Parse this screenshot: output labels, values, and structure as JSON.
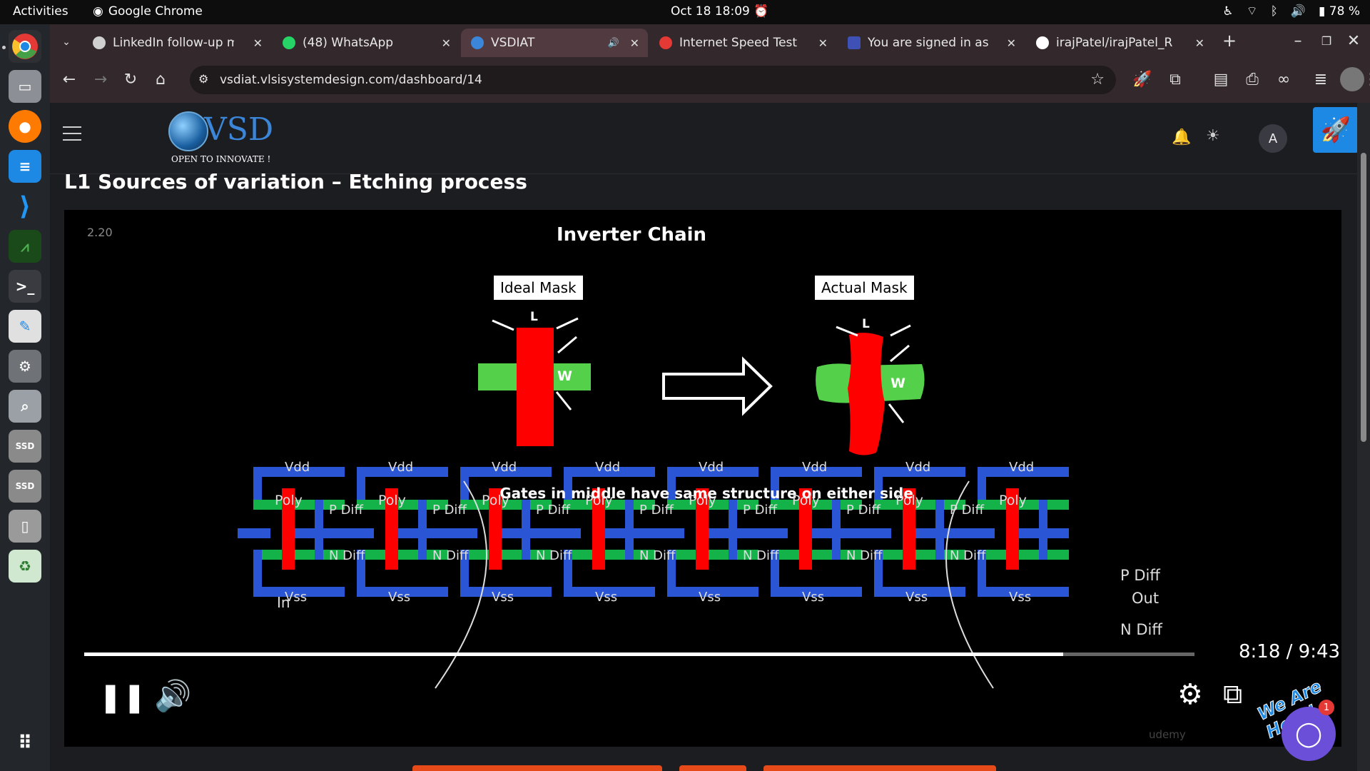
{
  "topbar": {
    "activities": "Activities",
    "app_name": "Google Chrome",
    "clock": "Oct 18  18:09",
    "battery": "78 %"
  },
  "tabs": [
    {
      "title": "LinkedIn follow-up m",
      "color": "#d0d0d0"
    },
    {
      "title": "(48) WhatsApp",
      "color": "#25d366"
    },
    {
      "title": "VSDIAT",
      "color": "#3b86d8"
    },
    {
      "title": "Internet Speed Test",
      "color": "#e53935"
    },
    {
      "title": "You are signed in as",
      "color": "#3f51b5"
    },
    {
      "title": "irajPatel/irajPatel_R",
      "color": "#ffffff"
    }
  ],
  "omnibox": {
    "url": "vsdiat.vlsisystemdesign.com/dashboard/14"
  },
  "site": {
    "logo_text": "VSD",
    "logo_tag": "OPEN TO INNOVATE !",
    "avatar": "A"
  },
  "page": {
    "title": "L1 Sources of variation – Etching process"
  },
  "slide": {
    "number": "2.20",
    "title": "Inverter Chain",
    "ideal_mask": "Ideal Mask",
    "actual_mask": "Actual Mask",
    "label_l": "L",
    "label_w": "W",
    "subtitle": "Gates in middle have same structure on either side",
    "vdd": "Vdd",
    "vss": "Vss",
    "poly": "Poly",
    "pdiff_short": "P Diff",
    "ndiff_short": "N Diff",
    "in_label": "In",
    "pdiff": "P Diff",
    "out": "Out",
    "ndiff": "N Diff"
  },
  "player": {
    "time": "8:18 / 9:43",
    "progress": 0.882,
    "watermark": "udemy"
  },
  "chat": {
    "banner": "We Are Here!",
    "badge": "1"
  },
  "colors": {
    "mask_red": "#ff0000",
    "mask_green": "#55d04a",
    "layout_blue": "#2a55d4",
    "layout_green": "#14b34a"
  }
}
